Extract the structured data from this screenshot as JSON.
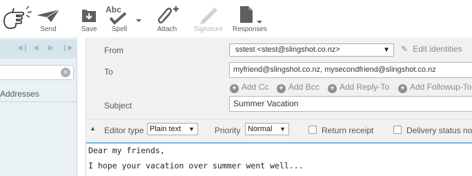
{
  "toolbar": {
    "send_label": "Send",
    "save_label": "Save",
    "spell_label": "Spell",
    "spell_icon_text": "Abc",
    "attach_label": "Attach",
    "signature_label": "Signature",
    "responses_label": "Responses"
  },
  "left_pane": {
    "search_clear": "×",
    "item_label": "Addresses"
  },
  "headers": {
    "from_label": "From",
    "from_value": "sstest <stest@slingshot.co.nz>",
    "edit_identities": "Edit identities",
    "to_label": "To",
    "to_value": "myfriend@slingshot.co.nz, mysecondfriend@slingshot.co.nz",
    "add_cc": "Add Cc",
    "add_bcc": "Add Bcc",
    "add_reply_to": "Add Reply-To",
    "add_followup_to": "Add Followup-To",
    "subject_label": "Subject",
    "subject_value": "Summer Vacation"
  },
  "options": {
    "editor_type_label": "Editor type",
    "editor_type_value": "Plain text",
    "priority_label": "Priority",
    "priority_value": "Normal",
    "return_receipt_label": "Return receipt",
    "delivery_status_label": "Delivery status not"
  },
  "body": {
    "line1": "Dear my friends,",
    "line2": "I hope your vacation over summer went well..."
  }
}
